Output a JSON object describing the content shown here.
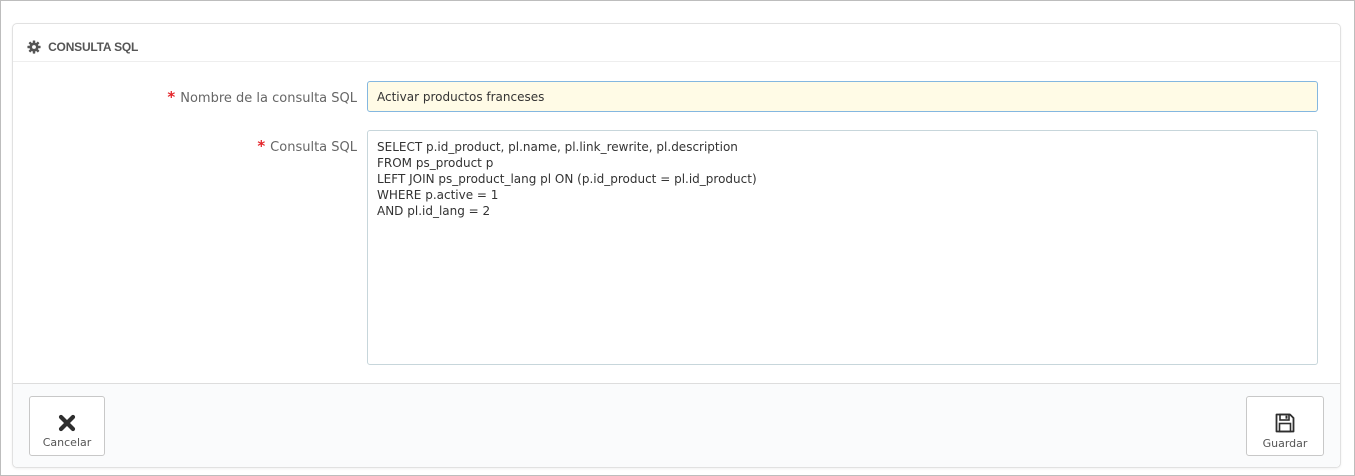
{
  "panel": {
    "title": "CONSULTA SQL",
    "heading_icon": "gear-icon"
  },
  "form": {
    "required_marker": "*",
    "name_label": "Nombre de la consulta SQL",
    "name_value": "Activar productos franceses",
    "sql_label": "Consulta SQL",
    "sql_value": "SELECT p.id_product, pl.name, pl.link_rewrite, pl.description\nFROM ps_product p\nLEFT JOIN ps_product_lang pl ON (p.id_product = pl.id_product)\nWHERE p.active = 1\nAND pl.id_lang = 2"
  },
  "footer": {
    "cancel_label": "Cancelar",
    "cancel_icon": "close-icon",
    "save_label": "Guardar",
    "save_icon": "floppy-disk-icon"
  },
  "colors": {
    "required": "#e4262b",
    "input_focus_bg": "#fffbe6",
    "input_focus_border": "#84b7e0"
  }
}
